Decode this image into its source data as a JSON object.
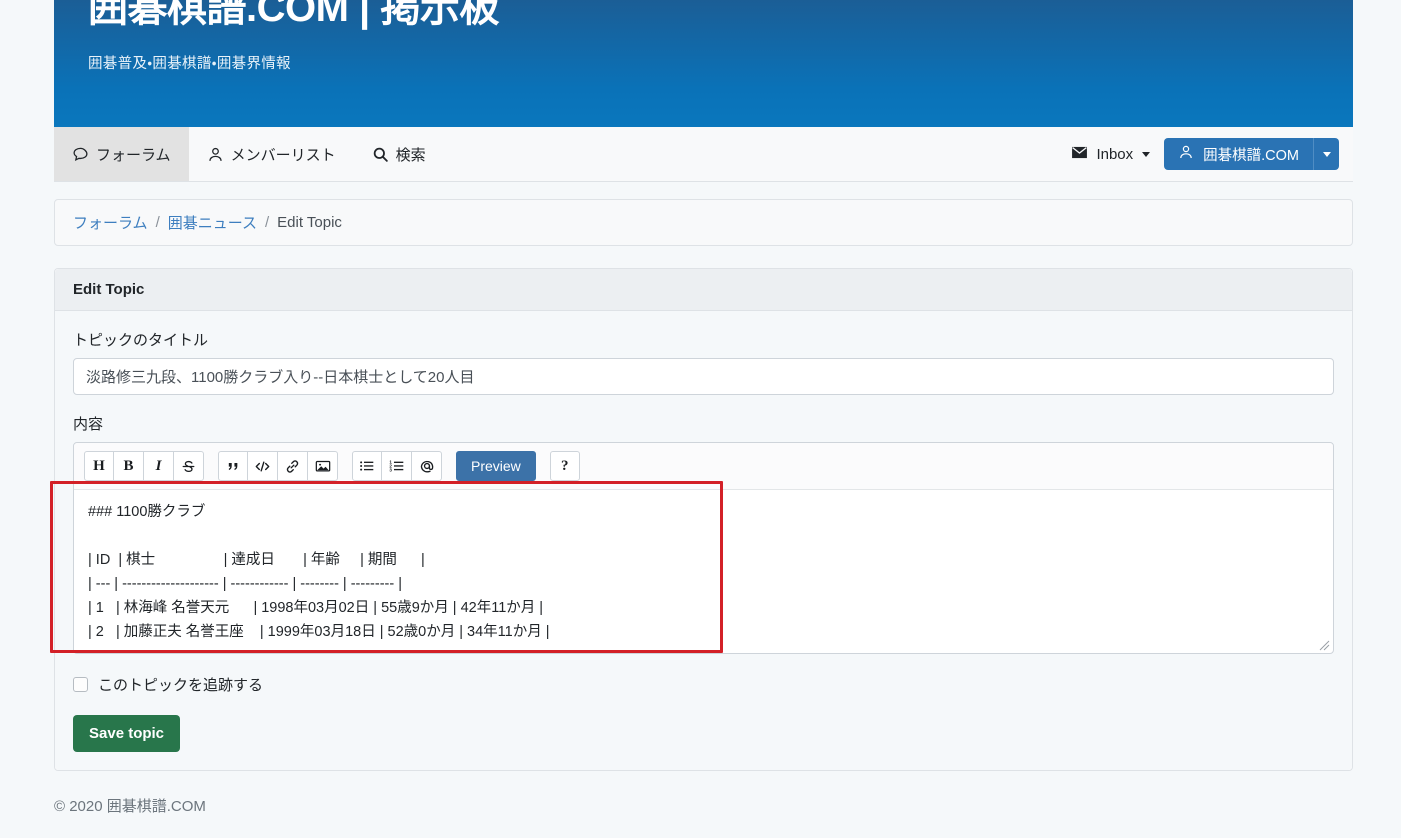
{
  "masthead": {
    "title": "囲碁棋譜.COM | 掲示板",
    "subtitle": "囲碁普及・囲碁棋譜・囲碁界情報",
    "gradient_top": "#1b5e96",
    "gradient_bottom": "#0a77bd"
  },
  "navbar": {
    "items": [
      {
        "label": "フォーラム",
        "icon": "comment-icon",
        "active": true
      },
      {
        "label": "メンバーリスト",
        "icon": "user-icon",
        "active": false
      },
      {
        "label": "検索",
        "icon": "search-icon",
        "active": false
      }
    ],
    "inbox": {
      "label": "Inbox",
      "icon": "envelope-icon"
    },
    "user": {
      "label": "囲碁棋譜.COM",
      "icon": "user-icon",
      "color": "#2a73b4"
    }
  },
  "breadcrumb": {
    "items": [
      "フォーラム",
      "囲碁ニュース",
      "Edit Topic"
    ],
    "separator": "/"
  },
  "card": {
    "header": "Edit Topic"
  },
  "form": {
    "title_label": "トピックのタイトル",
    "title_value": "淡路修三九段、1100勝クラブ入り--日本棋士として20人目",
    "title_placeholder": "トピックのタイトル",
    "content_label": "内容",
    "content_value": "### 1100勝クラブ\n\n| ID  | 棋士                 | 達成日       | 年齢     | 期間      |\n| --- | -------------------- | ------------ | -------- | --------- |\n| 1   | 林海峰 名誉天元      | 1998年03月02日 | 55歳9か月 | 42年11か月 |\n| 2   | 加藤正夫 名誉王座    | 1999年03月18日 | 52歳0か月 | 34年11か月 |",
    "content_placeholder": "内容",
    "follow_label": "このトピックを追跡する",
    "follow_checked": false,
    "save_label": "Save topic",
    "save_color": "#28764b"
  },
  "toolbar": {
    "groups": [
      [
        {
          "name": "heading-icon",
          "glyph": "H",
          "title": "Heading"
        },
        {
          "name": "bold-icon",
          "glyph": "B",
          "title": "Bold"
        },
        {
          "name": "italic-icon",
          "glyph": "I",
          "title": "Italic"
        },
        {
          "name": "strikethrough-icon",
          "glyph": "S",
          "title": "Strikethrough"
        }
      ],
      [
        {
          "name": "quote-icon",
          "glyph": "“",
          "title": "Quote"
        },
        {
          "name": "code-icon",
          "glyph": "</>",
          "title": "Code"
        },
        {
          "name": "link-icon",
          "glyph": "link",
          "title": "Link"
        },
        {
          "name": "image-icon",
          "glyph": "image",
          "title": "Image"
        }
      ],
      [
        {
          "name": "unordered-list-icon",
          "glyph": "ul",
          "title": "Bulleted list"
        },
        {
          "name": "ordered-list-icon",
          "glyph": "ol",
          "title": "Numbered list"
        },
        {
          "name": "mention-icon",
          "glyph": "@",
          "title": "Mention"
        }
      ]
    ],
    "preview_label": "Preview",
    "preview_color": "#3c72a8",
    "help_label": "?"
  },
  "annotation": {
    "color": "#d32027",
    "target": "content-textarea"
  },
  "footer": {
    "text": "© 2020 囲碁棋譜.COM"
  }
}
